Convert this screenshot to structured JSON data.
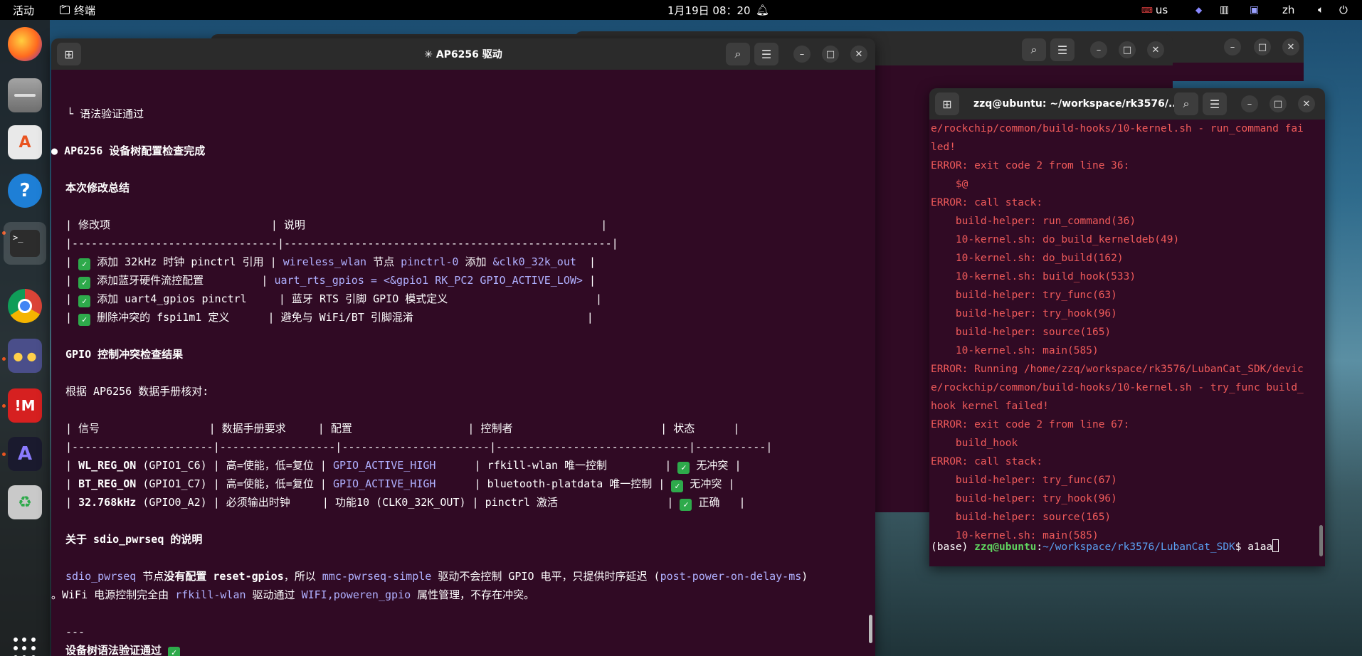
{
  "topbar": {
    "activities": "活动",
    "app_name": "终端",
    "clock": "1月19日  08：20",
    "input_method": "us",
    "language": "zh"
  },
  "dock": {
    "items": [
      "firefox-icon",
      "files-icon",
      "app-center-icon",
      "help-icon",
      "terminal-icon",
      "chrome-icon",
      "cat-app-icon",
      "im-app-icon",
      "ai-app-icon",
      "trash-icon"
    ]
  },
  "bg_window_b": {
    "title": ""
  },
  "main_window": {
    "title": "✳ AP6256 驱动",
    "lines": {
      "l0": "  └ 语法验证通过",
      "l1": "AP6256 设备树配置检查完成",
      "l2": "本次修改总结",
      "t1_header": "| 修改项                         | 说明                                              |",
      "t1_sep": "|--------------------------------|---------------------------------------------------|",
      "t1_r1_a": "| ",
      "t1_r1_b": " 添加 32kHz 时钟 pinctrl 引用 | ",
      "t1_r1_c": "wireless_wlan",
      "t1_r1_d": " 节点 ",
      "t1_r1_e": "pinctrl-0",
      "t1_r1_f": " 添加 ",
      "t1_r1_g": "&clk0_32k_out",
      "t1_r1_h": "  |",
      "t1_r2_b": " 添加蓝牙硬件流控配置         | ",
      "t1_r2_c": "uart_rts_gpios = <&gpio1 RK_PC2 GPIO_ACTIVE_LOW>",
      "t1_r2_h": " |",
      "t1_r3_b": " 添加 uart4_gpios pinctrl     | 蓝牙 RTS 引脚 GPIO 模式定义                       |",
      "t1_r4_b": " 删除冲突的 fspi1m1 定义      | 避免与 WiFi/BT 引脚混淆                           |",
      "l3": "GPIO 控制冲突检查结果",
      "l4": "根据 AP6256 数据手册核对:",
      "t2_header": "| 信号                 | 数据手册要求     | 配置                  | 控制者                       | 状态      |",
      "t2_sep": "|----------------------|------------------|-----------------------|------------------------------|-----------|",
      "t2_r1_sig": "WL_REG_ON",
      "t2_r1_a": " (GPIO1_C6) | 高=使能，低=复位 | ",
      "t2_r1_cfg": "GPIO_ACTIVE_HIGH",
      "t2_r1_b": "      | rfkill-wlan 唯一控制         | ",
      "t2_r1_st": " 无冲突 |",
      "t2_r2_sig": "BT_REG_ON",
      "t2_r2_a": " (GPIO1_C7) | 高=使能，低=复位 | ",
      "t2_r2_cfg": "GPIO_ACTIVE_HIGH",
      "t2_r2_b": "      | bluetooth-platdata 唯一控制 | ",
      "t2_r2_st": " 无冲突 |",
      "t2_r3_sig": "32.768kHz",
      "t2_r3_a": " (GPIO0_A2) | 必须输出时钟     | 功能10 (CLK0_32K_OUT) | pinctrl 激活                 | ",
      "t2_r3_st": " 正确   |",
      "l5_a": "关于 ",
      "l5_b": "sdio_pwrseq",
      "l5_c": " 的说明",
      "p1_a": "sdio_pwrseq",
      "p1_b": " 节点",
      "p1_c": "没有配置 reset-gpios",
      "p1_d": "，所以 ",
      "p1_e": "mmc-pwrseq-simple",
      "p1_f": " 驱动不会控制 GPIO 电平，只提供时序延迟 (",
      "p1_g": "post-power-on-delay-ms",
      "p1_h": ")",
      "p2_a": "。WiFi 电源控制完全由 ",
      "p2_b": "rfkill-wlan",
      "p2_c": " 驱动通过 ",
      "p2_d": "WIFI,poweren_gpio",
      "p2_e": " 属性管理，不存在冲突。",
      "l6": "---",
      "l7": "设备树语法验证通过 "
    }
  },
  "right_window": {
    "title": "zzq@ubuntu: ~/workspace/rk3576/...",
    "lines": [
      "e/rockchip/common/build-hooks/10-kernel.sh - run_command fai",
      "led!",
      "ERROR: exit code 2 from line 36:",
      "    $@",
      "ERROR: call stack:",
      "    build-helper: run_command(36)",
      "    10-kernel.sh: do_build_kerneldeb(49)",
      "    10-kernel.sh: do_build(162)",
      "    10-kernel.sh: build_hook(533)",
      "    build-helper: try_func(63)",
      "    build-helper: try_hook(96)",
      "    build-helper: source(165)",
      "    10-kernel.sh: main(585)",
      "ERROR: Running /home/zzq/workspace/rk3576/LubanCat_SDK/devic",
      "e/rockchip/common/build-hooks/10-kernel.sh - try_func build_",
      "hook kernel failed!",
      "ERROR: exit code 2 from line 67:",
      "    build_hook",
      "ERROR: call stack:",
      "    build-helper: try_func(67)",
      "    build-helper: try_hook(96)",
      "    build-helper: source(165)",
      "    10-kernel.sh: main(585)"
    ],
    "prompt_env": "(base) ",
    "prompt_user": "zzq@ubuntu",
    "prompt_colon": ":",
    "prompt_path": "~/workspace/rk3576/LubanCat_SDK",
    "prompt_dollar": "$ ",
    "command": "a1aa"
  }
}
